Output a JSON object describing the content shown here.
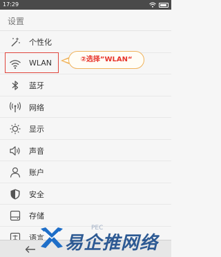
{
  "status_bar": {
    "time": "17:29"
  },
  "title": "设置",
  "items": [
    {
      "label": "个性化",
      "icon": "magic-wand-icon"
    },
    {
      "label": "WLAN",
      "icon": "wifi-icon"
    },
    {
      "label": "蓝牙",
      "icon": "bluetooth-icon"
    },
    {
      "label": "网络",
      "icon": "antenna-icon"
    },
    {
      "label": "显示",
      "icon": "brightness-icon"
    },
    {
      "label": "声音",
      "icon": "speaker-icon"
    },
    {
      "label": "账户",
      "icon": "person-icon"
    },
    {
      "label": "安全",
      "icon": "shield-icon"
    },
    {
      "label": "存储",
      "icon": "storage-icon"
    },
    {
      "label": "语言",
      "icon": "language-icon"
    }
  ],
  "annotation": {
    "text": "②选择”WLAN“"
  },
  "watermark": {
    "text": "易企推网络",
    "small": "PEC"
  },
  "colors": {
    "highlight_border": "#e0453c",
    "callout_border": "#f0b25a",
    "callout_text": "#e7352c",
    "watermark": "#1e4e8c"
  }
}
